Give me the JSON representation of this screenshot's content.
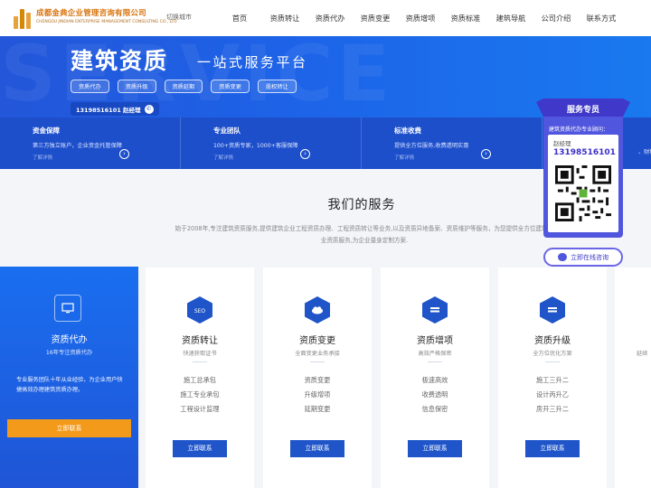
{
  "header": {
    "logo_cn": "成都金典企业管理咨询有限公司",
    "logo_en": "CHENGDU JINDIAN ENTERPRISE MANAGEMENT CONSULTING CO., LTD",
    "city_label": "切换城市",
    "nav": [
      "首页",
      "资质转让",
      "资质代办",
      "资质变更",
      "资质增项",
      "资质标准",
      "建筑导航",
      "公司介绍",
      "联系方式"
    ]
  },
  "banner": {
    "bg_text": "SERVICE",
    "title": "建筑资质",
    "subtitle": "一站式服务平台",
    "tags": [
      "资质代办",
      "资质升级",
      "资质延期",
      "资质变更",
      "股权转让"
    ],
    "phone_text": "13198516101 赵经理"
  },
  "features": [
    {
      "title": "资金保障",
      "desc": "第三方独立账户，企业资金托管保障",
      "link": "了解详情"
    },
    {
      "title": "专业团队",
      "desc": "100+资质专家，1000+客服保障",
      "link": "了解详情"
    },
    {
      "title": "标准收费",
      "desc": "提供全方位服务,收费透明实惠",
      "link": "了解详情"
    },
    {
      "title": "",
      "desc": "、财税解",
      "link": ""
    }
  ],
  "services": {
    "title": "我们的服务",
    "desc": "始于2008年,专注建筑资质服务,提供建筑企业工程资质办理、工程资质转让等业务,以及资质异地备案、资质维护等服务，为您提供全方位建筑企业资质服务,为企业量身定制方案."
  },
  "card_blue": {
    "title": "资质代办",
    "sub": "16年专注资质代办",
    "desc": "专业服务团队十年从业经验，为企业用户快捷高效办理建筑资质办理。",
    "button": "立即联系"
  },
  "cards": [
    {
      "icon": "seo-icon",
      "icon_text": "SEO",
      "title": "资质转让",
      "sub": "快速获取证书",
      "items": [
        "施工总承包",
        "施工专业承包",
        "工程设计监理"
      ],
      "button": "立即联系"
    },
    {
      "icon": "cloud-icon",
      "icon_text": "",
      "title": "资质变更",
      "sub": "全面变更业务承接",
      "items": [
        "资质变更",
        "升级增项",
        "延期变更"
      ],
      "button": "立即联系"
    },
    {
      "icon": "stack-icon",
      "icon_text": "",
      "title": "资质增项",
      "sub": "高效严格保密",
      "items": [
        "极速高效",
        "收费透明",
        "信息保密"
      ],
      "button": "立即联系"
    },
    {
      "icon": "stack-icon",
      "icon_text": "",
      "title": "资质升级",
      "sub": "全方位优化方案",
      "items": [
        "施工三升二",
        "设计丙升乙",
        "房开三升二"
      ],
      "button": "立即联系"
    }
  ],
  "card_edge_sub": "延续",
  "float_panel": {
    "title": "服务专员",
    "intro": "建筑资质代办专业顾问：",
    "name": "赵经理",
    "phone": "13198516101",
    "button": "立即在线咨询"
  },
  "colors": {
    "primary": "#1e4fcb",
    "accent": "#f39a1a",
    "float": "#5156de"
  }
}
